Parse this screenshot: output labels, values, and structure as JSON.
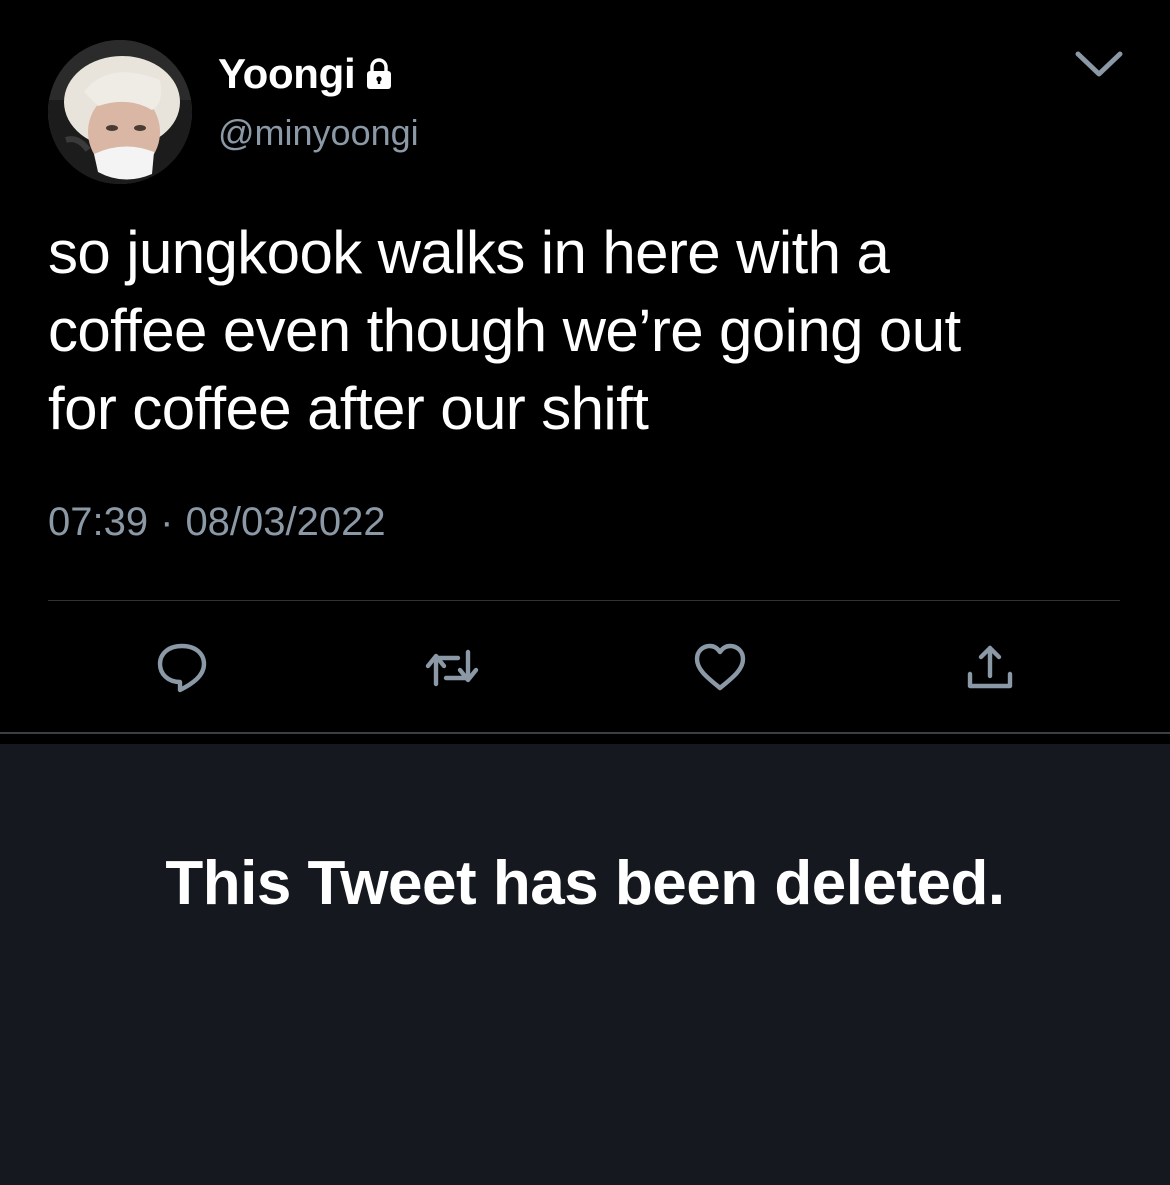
{
  "tweet": {
    "author": {
      "display_name": "Yoongi",
      "handle": "@minyoongi",
      "protected_icon": "lock-icon",
      "avatar": "profile-photo"
    },
    "menu_icon": "chevron-down-icon",
    "text_lines": [
      "so jungkook walks in here with a",
      "coffee even though we’re going out",
      "for coffee after our shift"
    ],
    "time": "07:39",
    "separator_dot": "·",
    "date": "08/03/2022",
    "actions": [
      {
        "icon": "reply-icon"
      },
      {
        "icon": "retweet-icon"
      },
      {
        "icon": "like-icon"
      },
      {
        "icon": "share-icon"
      }
    ]
  },
  "deleted_notice": {
    "text": "This Tweet has been deleted."
  },
  "colors": {
    "background": "#000000",
    "text_primary": "#ffffff",
    "text_secondary": "#8b98a5",
    "divider": "#2f3336",
    "icon": "#8b98a5",
    "deleted_panel_bg": "#15191f"
  }
}
